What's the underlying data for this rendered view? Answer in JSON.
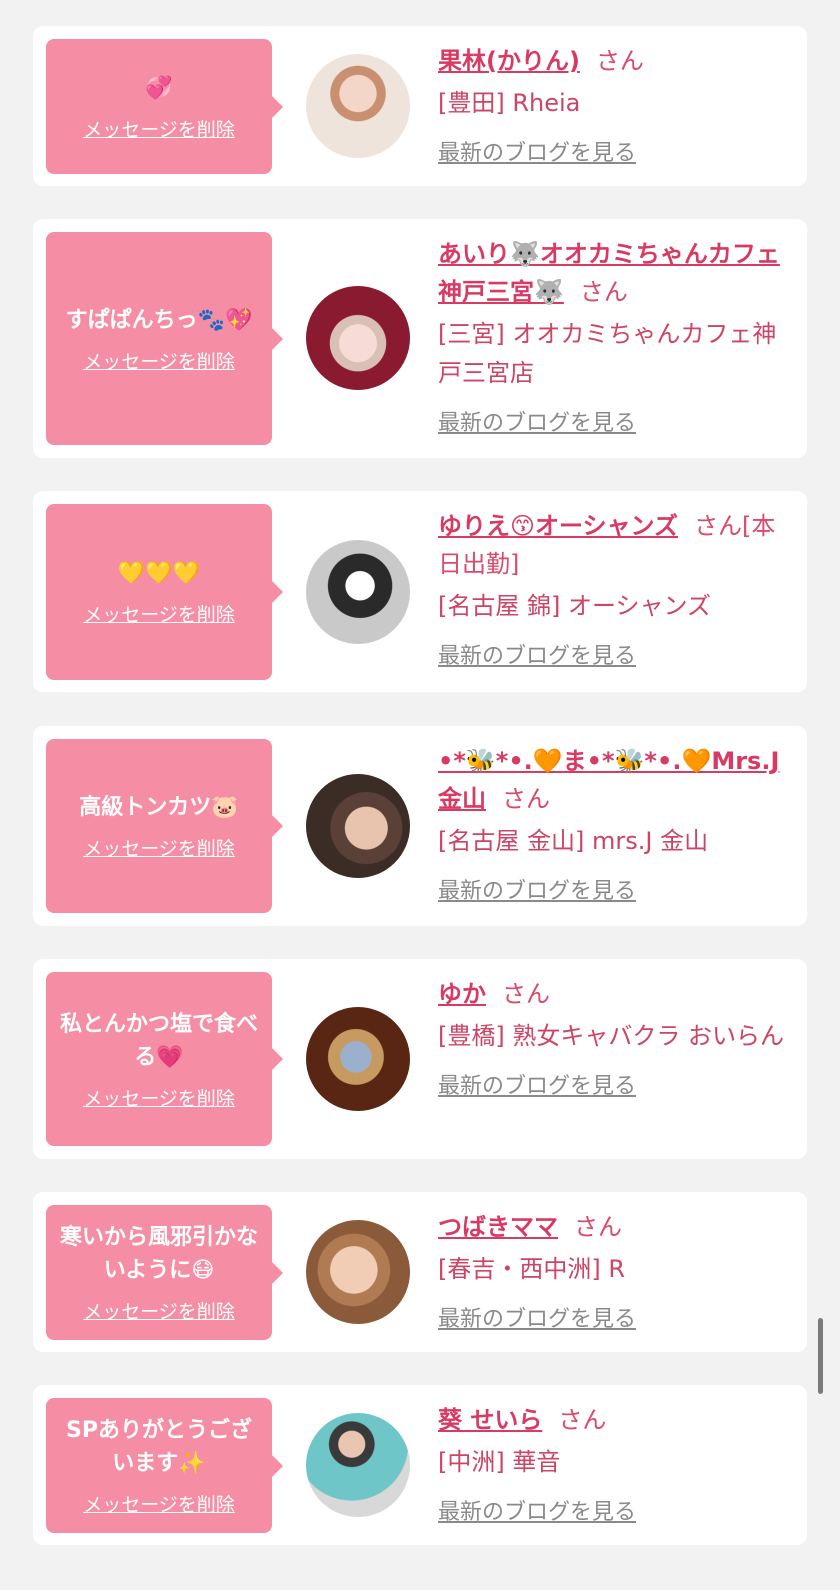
{
  "items": [
    {
      "message": "💞",
      "delete_label": "メッセージを削除",
      "name": "果林(かりん)",
      "san": "さん",
      "shop": "[豊田] Rheia",
      "blog_label": "最新のブログを見る"
    },
    {
      "message": "すぱぱんちっ🐾💖",
      "delete_label": "メッセージを削除",
      "name": "あいり🐺オオカミちゃんカフェ神戸三宮🐺",
      "san": "さん",
      "shop": "[三宮] オオカミちゃんカフェ神戸三宮店",
      "blog_label": "最新のブログを見る"
    },
    {
      "message": "💛💛💛",
      "delete_label": "メッセージを削除",
      "name": "ゆりえ😙オーシャンズ",
      "san": "さん[本日出勤]",
      "shop": "[名古屋 錦] オーシャンズ",
      "blog_label": "最新のブログを見る"
    },
    {
      "message": "高級トンカツ🐷",
      "delete_label": "メッセージを削除",
      "name": "•*🐝*•.🧡ま•*🐝*•.🧡Mrs.J金山",
      "san": "さん",
      "shop": "[名古屋 金山] mrs.J 金山",
      "blog_label": "最新のブログを見る"
    },
    {
      "message": "私とんかつ塩で食べる💗",
      "delete_label": "メッセージを削除",
      "name": "ゆか",
      "san": "さん",
      "shop": "[豊橋] 熟女キャバクラ おいらん",
      "blog_label": "最新のブログを見る"
    },
    {
      "message": "寒いから風邪引かないように😷",
      "delete_label": "メッセージを削除",
      "name": "つばきママ",
      "san": "さん",
      "shop": "[春吉・西中洲] R",
      "blog_label": "最新のブログを見る"
    },
    {
      "message": "SPありがとうございます✨",
      "delete_label": "メッセージを削除",
      "name": "葵 せいら",
      "san": "さん",
      "shop": "[中洲] 華音",
      "blog_label": "最新のブログを見る"
    }
  ],
  "colors": {
    "bubble": "#f58ea4",
    "name": "#d93a63",
    "blog_link": "#8a8a8a",
    "background": "#f2f2f2"
  }
}
